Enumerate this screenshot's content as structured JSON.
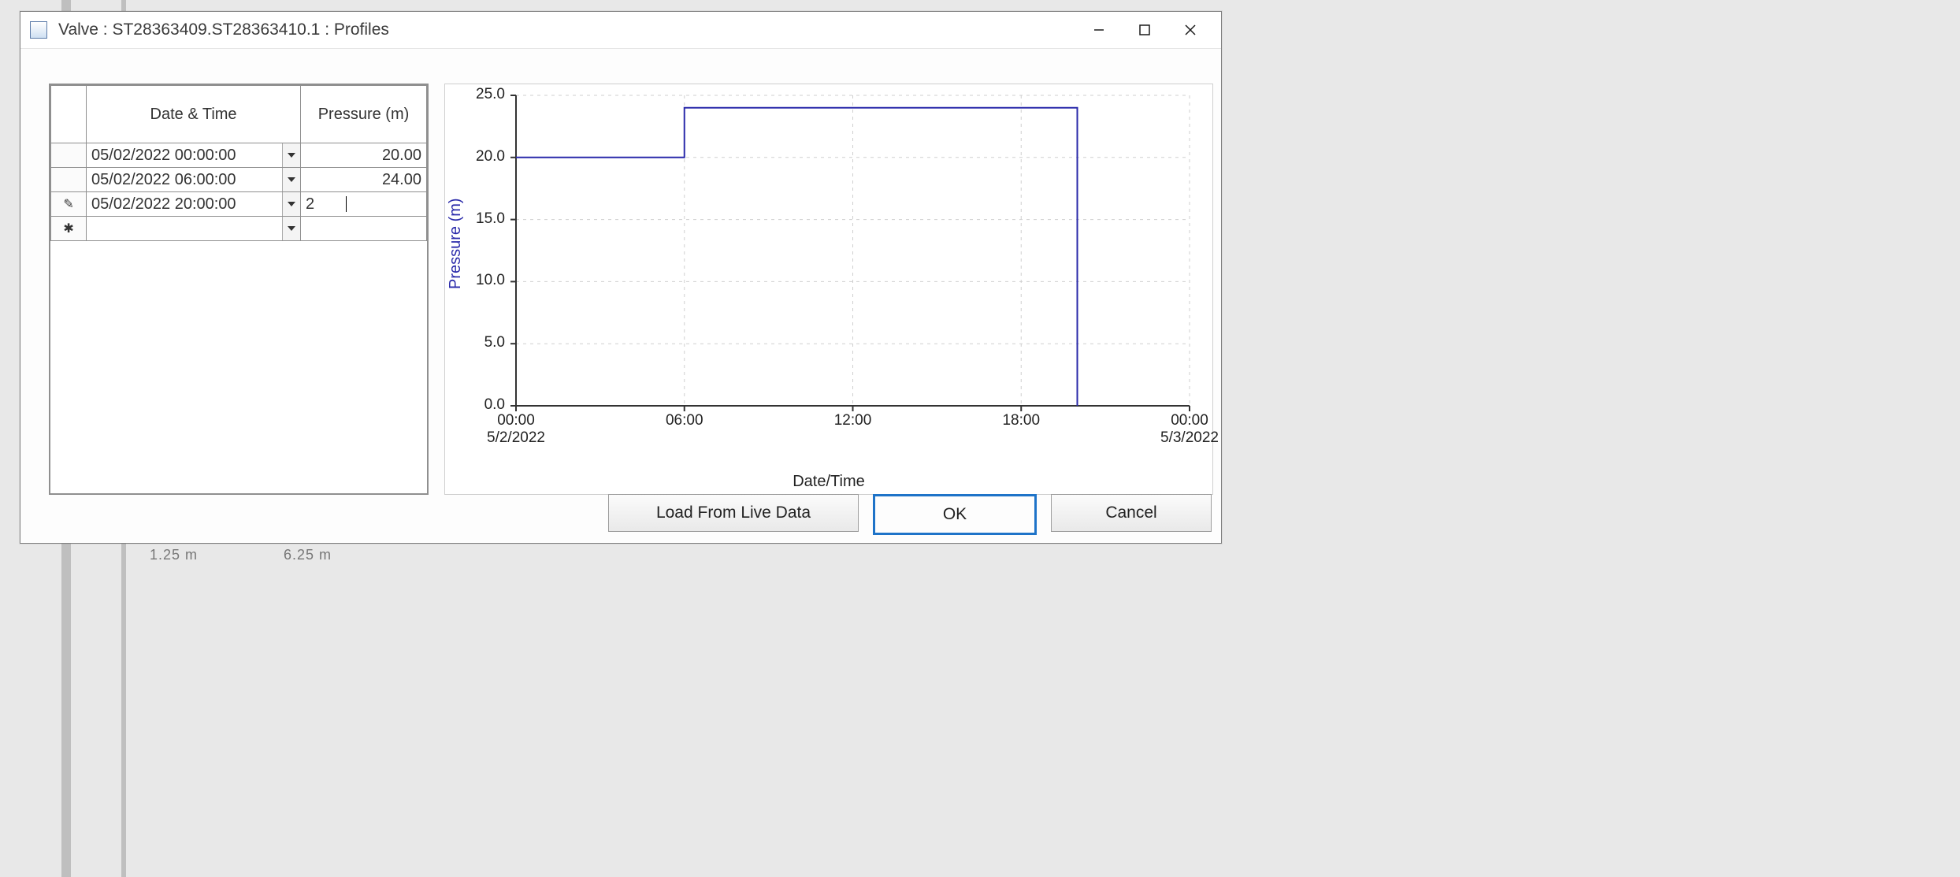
{
  "window": {
    "title": "Valve : ST28363409.ST28363410.1 : Profiles"
  },
  "grid": {
    "columns": {
      "datetime": "Date & Time",
      "pressure": "Pressure (m)"
    },
    "rows": [
      {
        "marker": "",
        "datetime": "05/02/2022 00:00:00",
        "pressure": "20.00"
      },
      {
        "marker": "",
        "datetime": "05/02/2022 06:00:00",
        "pressure": "24.00"
      },
      {
        "marker": "✎",
        "datetime": "05/02/2022 20:00:00",
        "pressure": "2",
        "editing": true
      },
      {
        "marker": "✱",
        "datetime": "",
        "pressure": ""
      }
    ]
  },
  "chart_axes": {
    "ylabel": "Pressure (m)",
    "xlabel": "Date/Time",
    "yticks": [
      "0.0",
      "5.0",
      "10.0",
      "15.0",
      "20.0",
      "25.0"
    ],
    "xticks": [
      {
        "t": "00:00",
        "d": "5/2/2022"
      },
      {
        "t": "06:00",
        "d": ""
      },
      {
        "t": "12:00",
        "d": ""
      },
      {
        "t": "18:00",
        "d": ""
      },
      {
        "t": "00:00",
        "d": "5/3/2022"
      }
    ]
  },
  "buttons": {
    "load": "Load From Live Data",
    "ok": "OK",
    "cancel": "Cancel"
  },
  "bg": {
    "t1": "1.25 m",
    "t2": "6.25 m"
  },
  "chart_data": {
    "type": "line",
    "title": "",
    "xlabel": "Date/Time",
    "ylabel": "Pressure (m)",
    "ylim": [
      0,
      25
    ],
    "x_range": [
      "2022-05-02T00:00:00",
      "2022-05-03T00:00:00"
    ],
    "step_interpolation": true,
    "series": [
      {
        "name": "Pressure",
        "points": [
          {
            "x": "2022-05-02T00:00:00",
            "y": 20.0
          },
          {
            "x": "2022-05-02T06:00:00",
            "y": 24.0
          },
          {
            "x": "2022-05-02T20:00:00",
            "y": 0.0
          }
        ]
      }
    ]
  }
}
